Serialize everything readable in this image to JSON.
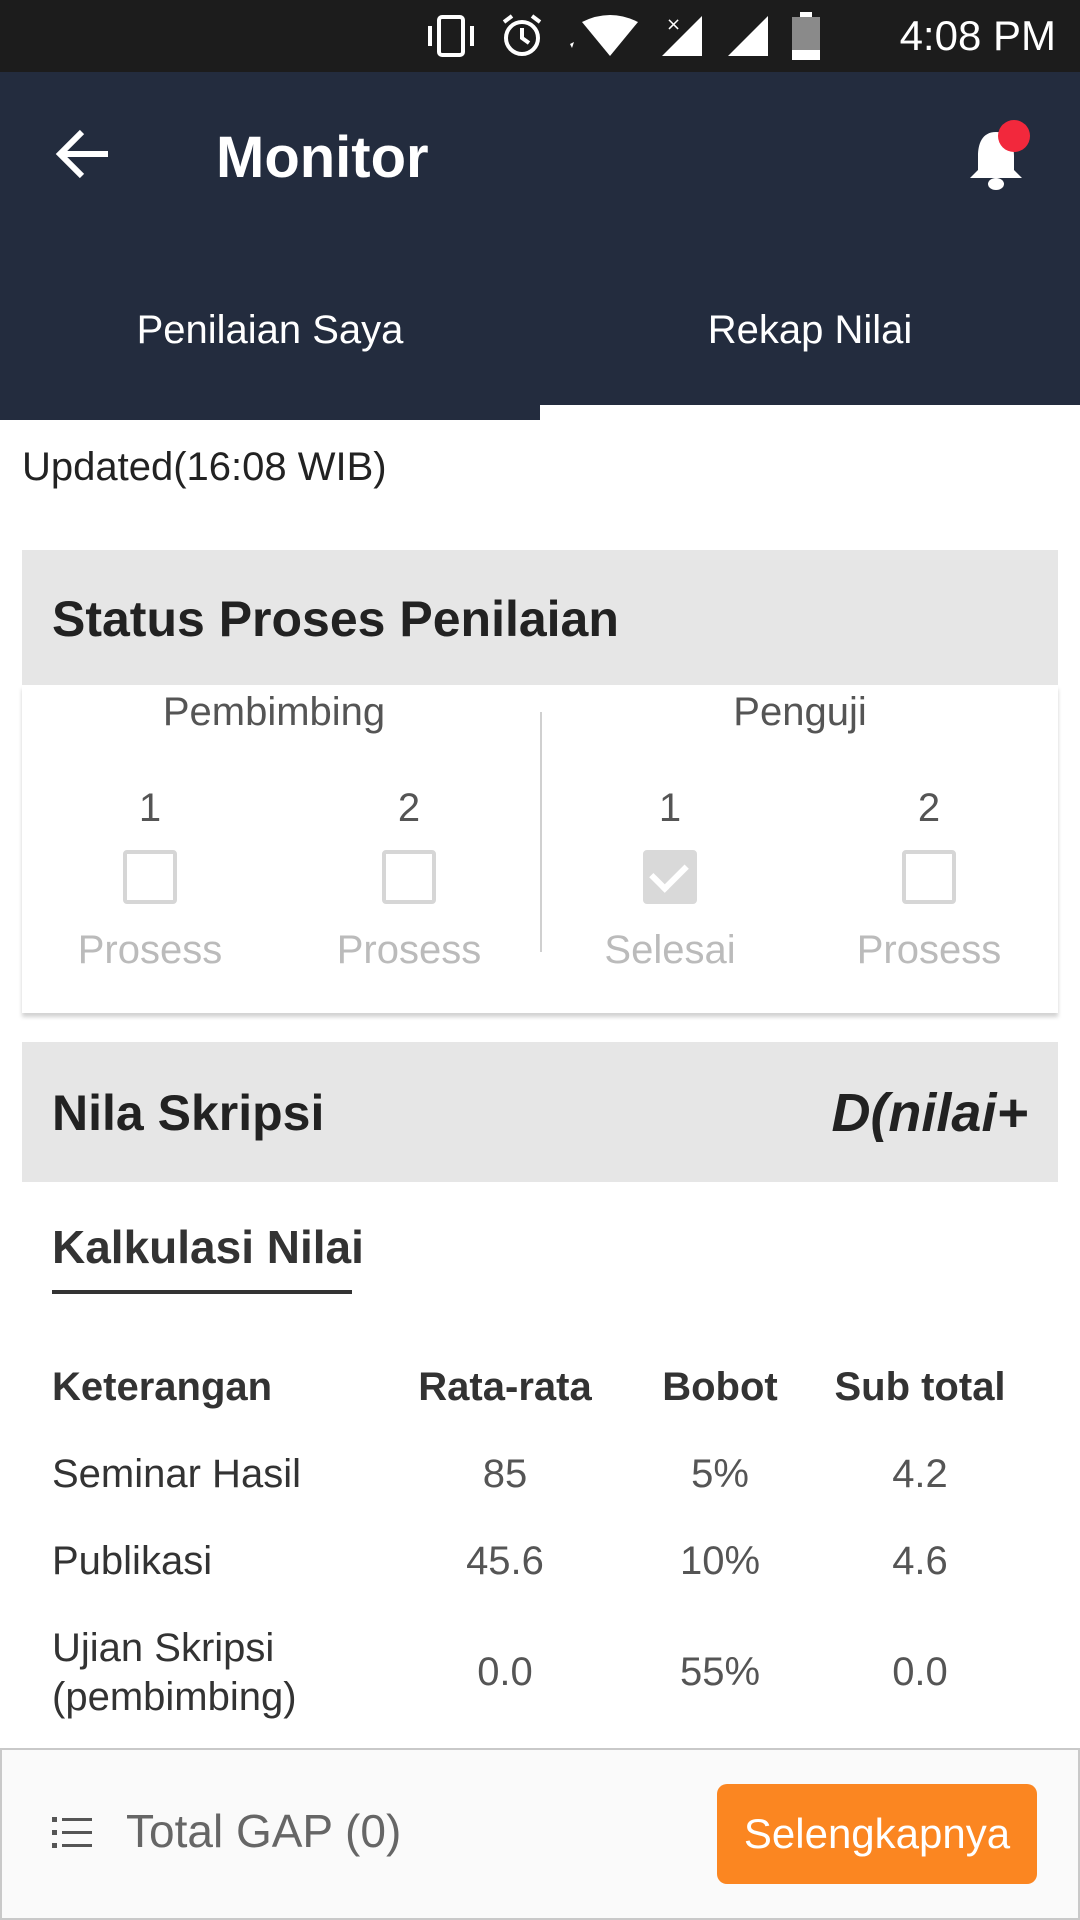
{
  "status_bar": {
    "time": "4:08 PM"
  },
  "app_bar": {
    "title": "Monitor"
  },
  "tabs": [
    {
      "label": "Penilaian Saya",
      "active": false
    },
    {
      "label": "Rekap Nilai",
      "active": true
    }
  ],
  "updated": "Updated(16:08 WIB)",
  "status_section": {
    "title": "Status Proses Penilaian",
    "groups": [
      {
        "label": "Pembimbing",
        "items": [
          {
            "number": "1",
            "status": "Prosess",
            "checked": false
          },
          {
            "number": "2",
            "status": "Prosess",
            "checked": false
          }
        ]
      },
      {
        "label": "Penguji",
        "items": [
          {
            "number": "1",
            "status": "Selesai",
            "checked": true
          },
          {
            "number": "2",
            "status": "Prosess",
            "checked": false
          }
        ]
      }
    ]
  },
  "nilai_section": {
    "title": "Nila Skripsi",
    "grade": "D(nilai+",
    "subtitle": "Kalkulasi Nilai",
    "table": {
      "headers": [
        "Keterangan",
        "Rata-rata",
        "Bobot",
        "Sub total"
      ],
      "rows": [
        {
          "keterangan_1": "Seminar Hasil",
          "keterangan_2": "",
          "rata": "85",
          "bobot": "5%",
          "subtotal": "4.2"
        },
        {
          "keterangan_1": "Publikasi",
          "keterangan_2": "",
          "rata": "45.6",
          "bobot": "10%",
          "subtotal": "4.6"
        },
        {
          "keterangan_1": "Ujian Skripsi",
          "keterangan_2": "(pembimbing)",
          "rata": "0.0",
          "bobot": "55%",
          "subtotal": "0.0"
        }
      ]
    }
  },
  "bottom_bar": {
    "gap_label": "Total GAP (0)",
    "button_label": "Selengkapnya"
  },
  "colors": {
    "app_bar": "#232c3e",
    "accent_orange": "#fb8621",
    "notification_dot": "#f2283c"
  }
}
